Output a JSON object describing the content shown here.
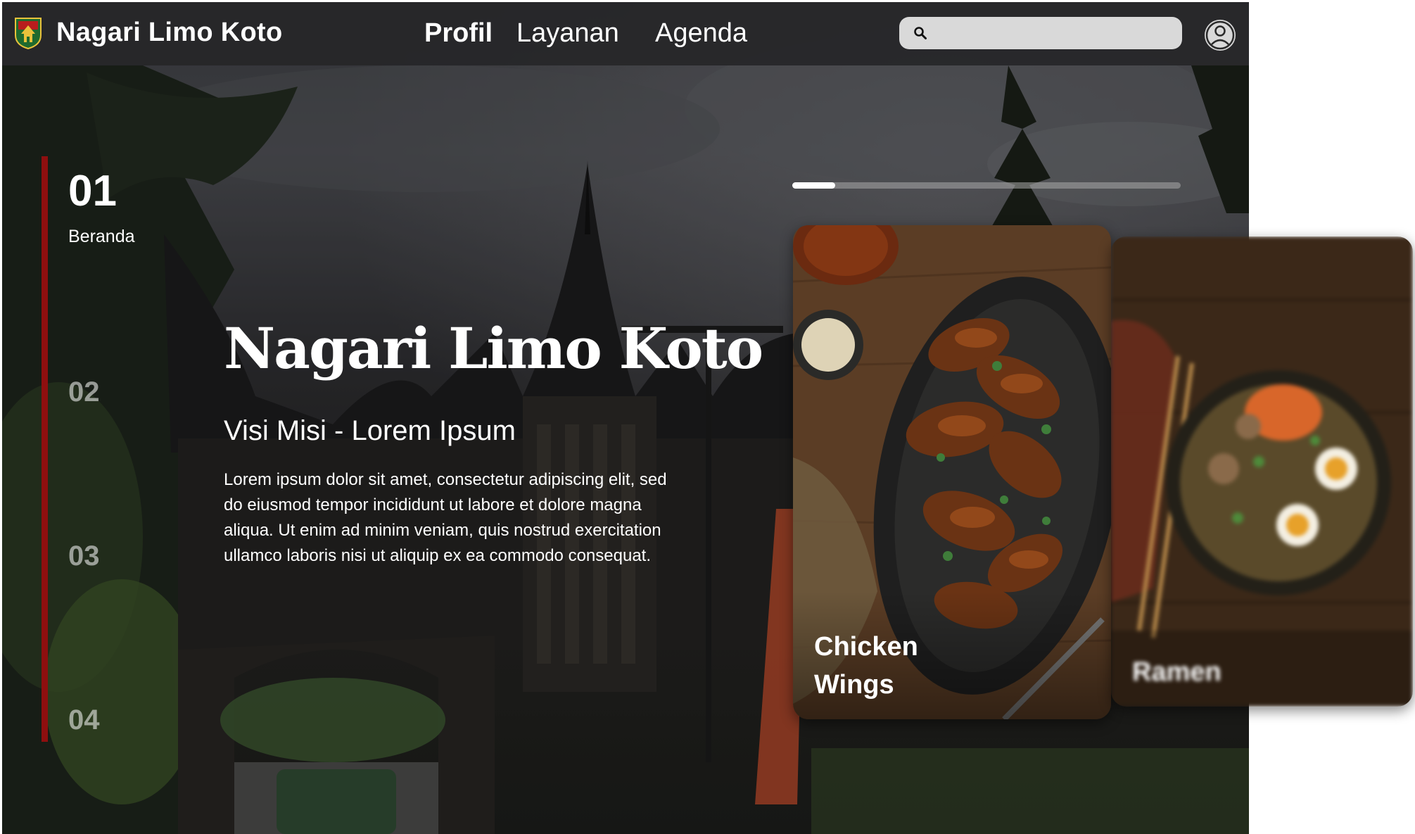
{
  "header": {
    "brand": "Nagari Limo Koto",
    "nav": [
      "Profil",
      "Layanan",
      "Agenda"
    ],
    "active_nav": "Profil",
    "search": {
      "placeholder": "",
      "value": ""
    }
  },
  "sidebar": {
    "steps": [
      "01",
      "02",
      "03",
      "04"
    ],
    "current_step": "01",
    "current_label": "Beranda"
  },
  "hero": {
    "title": "Nagari Limo Koto",
    "subtitle": "Visi Misi - Lorem Ipsum",
    "body": "Lorem ipsum dolor sit amet, consectetur adipiscing elit, sed do eiusmod tempor incididunt ut labore et dolore magna aliqua. Ut enim ad minim veniam, quis nostrud exercitation ullamco laboris nisi ut aliquip ex ea commodo consequat."
  },
  "slider": {
    "progress_fraction": 0.11
  },
  "cards": [
    {
      "title_line1": "Chicken",
      "title_line2": "Wings",
      "state": "active"
    },
    {
      "title": "Ramen",
      "state": "blurred"
    }
  ],
  "colors": {
    "accent_red": "#8e0f0f",
    "topbar": "#262628",
    "search_bg": "#d9d9d9"
  }
}
